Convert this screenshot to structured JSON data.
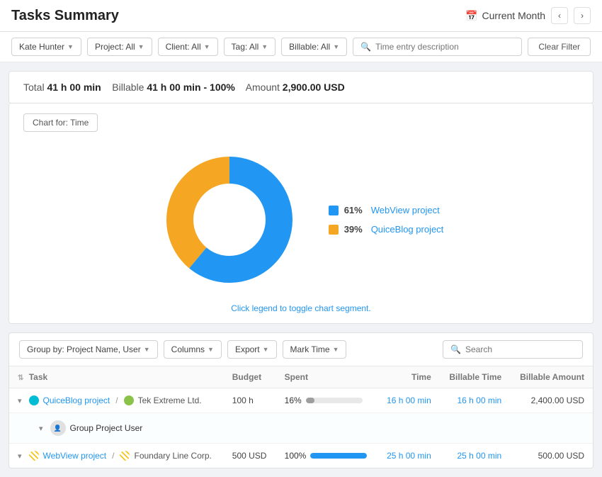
{
  "header": {
    "title": "Tasks Summary",
    "period_label": "Current Month",
    "nav_prev": "‹",
    "nav_next": "›",
    "cal_icon": "📅"
  },
  "filters": {
    "user": "Kate Hunter",
    "project": "Project: All",
    "client": "Client: All",
    "tag": "Tag: All",
    "billable": "Billable: All",
    "search_placeholder": "Time entry description",
    "clear_label": "Clear Filter"
  },
  "summary": {
    "total_label": "Total",
    "total_value": "41 h 00 min",
    "billable_label": "Billable",
    "billable_value": "41 h 00 min",
    "billable_pct": "100%",
    "amount_label": "Amount",
    "amount_value": "2,900.00 USD"
  },
  "chart": {
    "for_label": "Chart for: Time",
    "hint": "Click legend to toggle chart segment.",
    "segments": [
      {
        "label": "WebView project",
        "pct": 61,
        "color": "#2196f3"
      },
      {
        "label": "QuiceBlog project",
        "pct": 39,
        "color": "#f5a623"
      }
    ]
  },
  "table": {
    "group_by_label": "Group by: Project Name, User",
    "columns_label": "Columns",
    "export_label": "Export",
    "mark_time_label": "Mark Time",
    "search_placeholder": "Search",
    "columns": {
      "task": "Task",
      "budget": "Budget",
      "spent": "Spent",
      "time": "Time",
      "billable_time": "Billable Time",
      "billable_amount": "Billable Amount"
    },
    "rows": [
      {
        "id": "quiceblog",
        "expanded": true,
        "project_name": "QuiceBlog project",
        "project_color": "#00bcd4",
        "separator": "/",
        "client_name": "Tek Extreme Ltd.",
        "client_color": "#8bc34a",
        "budget": "100 h",
        "spent_pct": "16%",
        "spent_bar_pct": 16,
        "spent_bar_color": "#9e9e9e",
        "time": "16 h 00 min",
        "billable_time": "16 h 00 min",
        "billable_amount": "2,400.00 USD"
      },
      {
        "id": "webview",
        "expanded": true,
        "project_name": "WebView project",
        "is_hatch": true,
        "separator": "/",
        "client_name": "Foundary Line Corp.",
        "client_is_hatch": true,
        "budget": "500 USD",
        "spent_pct": "100%",
        "spent_bar_pct": 100,
        "spent_bar_color": "#2196f3",
        "time": "25 h 00 min",
        "billable_time": "25 h 00 min",
        "billable_amount": "500.00 USD"
      }
    ],
    "subrow_label": "Group Project User"
  }
}
